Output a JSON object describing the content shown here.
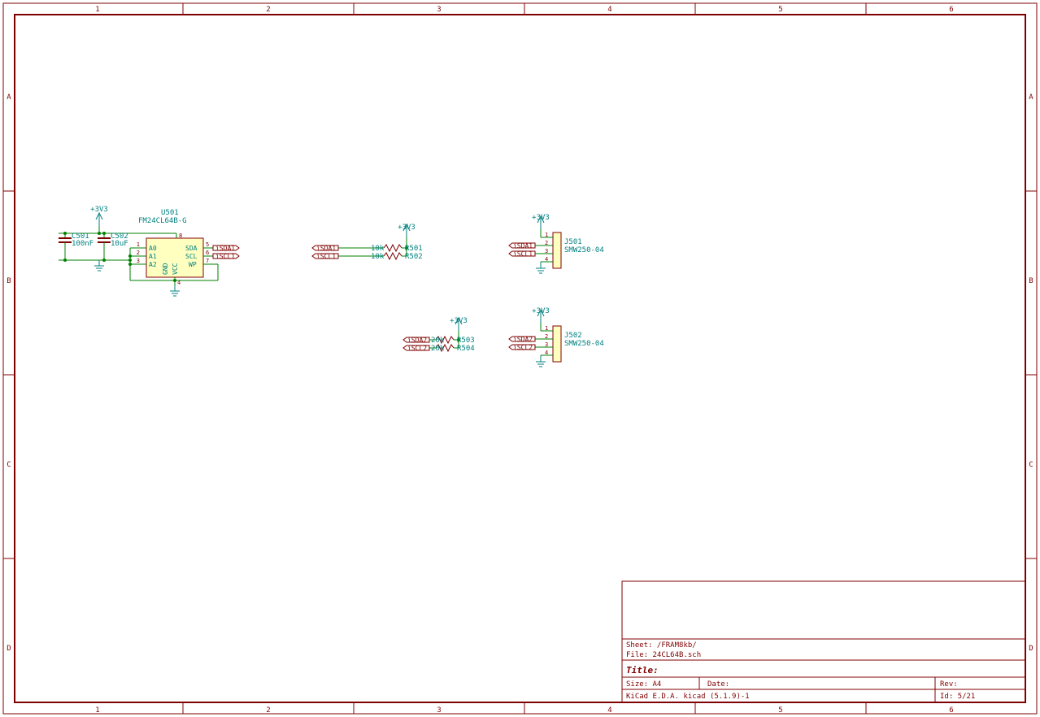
{
  "power": {
    "rail": "+3V3"
  },
  "u501": {
    "ref": "U501",
    "val": "FM24CL64B-G",
    "pins": {
      "A0": "A0",
      "A1": "A1",
      "A2": "A2",
      "GND": "GND",
      "VCC": "VCC",
      "SDA": "SDA",
      "SCL": "SCL",
      "WP": "WP",
      "n1": "1",
      "n2": "2",
      "n3": "3",
      "n4": "4",
      "n5": "5",
      "n6": "6",
      "n7": "7",
      "n8": "8"
    }
  },
  "c501": {
    "ref": "C501",
    "val": "100nF"
  },
  "c502": {
    "ref": "C502",
    "val": "10uF"
  },
  "r501": {
    "ref": "R501",
    "val": "10k"
  },
  "r502": {
    "ref": "R502",
    "val": "10k"
  },
  "r503": {
    "ref": "R503",
    "val": "20k"
  },
  "r504": {
    "ref": "R504",
    "val": "20k"
  },
  "j501": {
    "ref": "J501",
    "val": "SMW250-04",
    "p1": "1",
    "p2": "2",
    "p3": "3",
    "p4": "4"
  },
  "j502": {
    "ref": "J502",
    "val": "SMW250-04",
    "p1": "1",
    "p2": "2",
    "p3": "3",
    "p4": "4"
  },
  "nets": {
    "isda1": "iSDA1",
    "iscl1": "iSCL1",
    "isda2": "iSDA2",
    "iscl2": "iSCL2"
  },
  "titleblock": {
    "sheet": "Sheet: /FRAM8kb/",
    "file": "File: 24CL64B.sch",
    "titlelabel": "Title:",
    "size": "Size: A4",
    "date": "Date:",
    "rev": "Rev:",
    "kicad": "KiCad E.D.A.  kicad (5.1.9)-1",
    "id": "Id: 5/21"
  },
  "ruler": {
    "h": [
      "1",
      "2",
      "3",
      "4",
      "5",
      "6"
    ],
    "v": [
      "A",
      "B",
      "C",
      "D"
    ]
  }
}
